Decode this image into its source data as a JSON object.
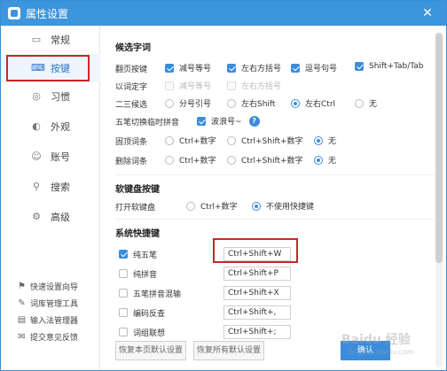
{
  "window": {
    "title": "属性设置",
    "close_glyph": "✕"
  },
  "sidebar": {
    "items": [
      {
        "label": "常规",
        "icon": "monitor-icon"
      },
      {
        "label": "按键",
        "icon": "keyboard-icon",
        "active": true
      },
      {
        "label": "习惯",
        "icon": "habit-icon"
      },
      {
        "label": "外观",
        "icon": "appearance-icon"
      },
      {
        "label": "账号",
        "icon": "account-icon"
      },
      {
        "label": "搜索",
        "icon": "search-icon"
      },
      {
        "label": "高级",
        "icon": "gear-icon"
      }
    ],
    "tools": [
      {
        "label": "快速设置向导",
        "icon": "flag-icon"
      },
      {
        "label": "词库管理工具",
        "icon": "dictionary-icon"
      },
      {
        "label": "输入法管理器",
        "icon": "manager-icon"
      },
      {
        "label": "提交意见反馈",
        "icon": "feedback-icon"
      }
    ]
  },
  "candidate": {
    "section_title": "候选字词",
    "paging": {
      "label": "翻页按键",
      "options": [
        {
          "label": "减号等号",
          "checked": true
        },
        {
          "label": "左右方括号",
          "checked": true
        },
        {
          "label": "逗号句号",
          "checked": true
        },
        {
          "label": "Shift+Tab/Tab",
          "checked": true
        }
      ]
    },
    "word_select": {
      "label": "以词定字",
      "options": [
        {
          "label": "减号等号",
          "checked": false,
          "disabled": true
        },
        {
          "label": "左右方括号",
          "checked": false,
          "disabled": true
        }
      ]
    },
    "second_third": {
      "label": "二三候选",
      "options": [
        {
          "label": "分号引号",
          "checked": false
        },
        {
          "label": "左右Shift",
          "checked": false
        },
        {
          "label": "左右Ctrl",
          "checked": true
        },
        {
          "label": "无",
          "checked": false
        }
      ]
    },
    "wubi_pinyin": {
      "label": "五笔切换临时拼音",
      "option": {
        "label": "波浪号~",
        "checked": true
      },
      "help_glyph": "?"
    },
    "pin_word": {
      "label": "固顶词条",
      "options": [
        {
          "label": "Ctrl+数字",
          "checked": false
        },
        {
          "label": "Ctrl+Shift+数字",
          "checked": false
        },
        {
          "label": "无",
          "checked": true
        }
      ]
    },
    "delete_word": {
      "label": "删除词条",
      "options": [
        {
          "label": "Ctrl+数字",
          "checked": false
        },
        {
          "label": "Ctrl+Shift+数字",
          "checked": false
        },
        {
          "label": "无",
          "checked": true
        }
      ]
    }
  },
  "soft_keyboard": {
    "section_title": "软键盘按键",
    "open": {
      "label": "打开软键盘",
      "options": [
        {
          "label": "Ctrl+数字",
          "checked": false
        },
        {
          "label": "不使用快捷键",
          "checked": true
        }
      ]
    }
  },
  "system_hotkeys": {
    "section_title": "系统快捷键",
    "rows": [
      {
        "label": "纯五笔",
        "checked": true,
        "value": "Ctrl+Shift+W"
      },
      {
        "label": "纯拼音",
        "checked": false,
        "value": "Ctrl+Shift+P"
      },
      {
        "label": "五笔拼音混输",
        "checked": false,
        "value": "Ctrl+Shift+X"
      },
      {
        "label": "编码反查",
        "checked": false,
        "value": "Ctrl+Shift+,"
      },
      {
        "label": "词组联想",
        "checked": false,
        "value": "Ctrl+Shift+;"
      }
    ]
  },
  "footer": {
    "restore_page": "恢复本页默认设置",
    "restore_all": "恢复所有默认设置",
    "confirm": "确认"
  },
  "watermark": {
    "main": "Baidu 经验",
    "sub": "jingyan.baidu.com"
  },
  "colors": {
    "accent": "#3d95dc",
    "highlight": "#c62828"
  }
}
